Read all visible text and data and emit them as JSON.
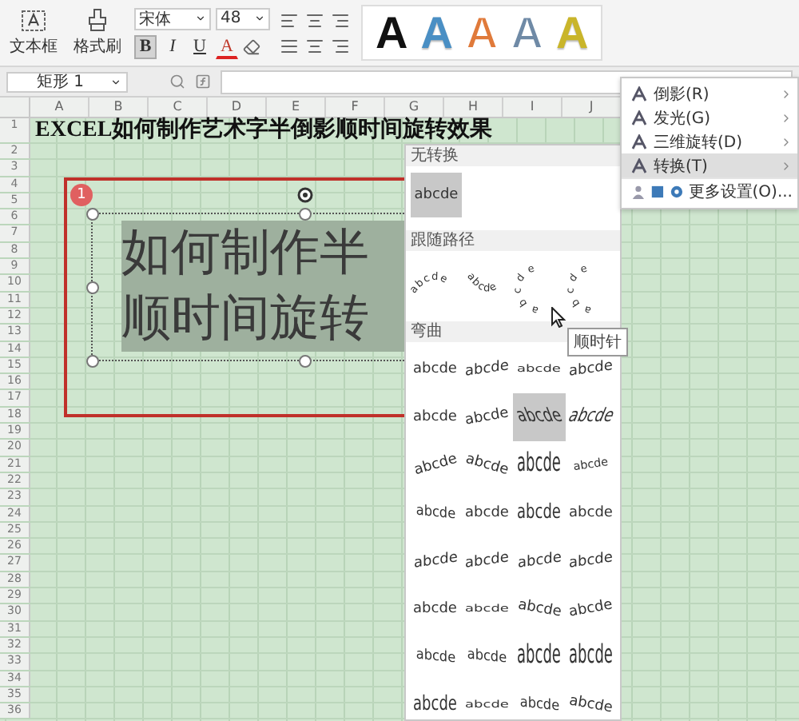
{
  "ribbon": {
    "textbox_label": "文本框",
    "format_painter_label": "格式刷",
    "font": "宋体",
    "font_size": "48",
    "bold": {
      "label": "B",
      "on": true
    },
    "italic": {
      "label": "I"
    },
    "underline": {
      "label": "U"
    },
    "font_color": {
      "label": "A"
    },
    "wordart_styles": [
      {
        "label": "A",
        "kind": "solid",
        "color": "#111111"
      },
      {
        "label": "A",
        "kind": "soft",
        "color": "#4a8fc4"
      },
      {
        "label": "A",
        "kind": "outline",
        "color": "#e07a3a"
      },
      {
        "label": "A",
        "kind": "outline",
        "color": "#6f8aa6"
      },
      {
        "label": "A",
        "kind": "soft",
        "color": "#c9b52a"
      }
    ]
  },
  "formula_bar": {
    "name_box": "矩形 1"
  },
  "columns": [
    "A",
    "B",
    "C",
    "D",
    "E",
    "F",
    "G",
    "H",
    "I",
    "J"
  ],
  "rows": [
    "1",
    "2",
    "3",
    "4",
    "5",
    "6",
    "7",
    "8",
    "9",
    "10",
    "11",
    "12",
    "13",
    "14",
    "15",
    "16",
    "17",
    "18",
    "19",
    "20",
    "21",
    "22",
    "23",
    "24",
    "25",
    "26",
    "27",
    "28",
    "29",
    "30",
    "31",
    "32",
    "33",
    "34",
    "35",
    "36"
  ],
  "title": "EXCEL如何制作艺术字半倒影顺时间旋转效果",
  "shape": {
    "badge": "1",
    "lines": [
      "如何制作半",
      "顺时间旋转"
    ]
  },
  "effects_menu": {
    "items": [
      {
        "label": "倒影(R)",
        "highlighted": false
      },
      {
        "label": "发光(G)",
        "highlighted": false
      },
      {
        "label": "三维旋转(D)",
        "highlighted": false
      },
      {
        "label": "转换(T)",
        "highlighted": true
      }
    ],
    "more": "更多设置(O)..."
  },
  "transform_gallery": {
    "sections": [
      {
        "title": "无转换",
        "kind": "single",
        "items": [
          {
            "text": "abcde",
            "kind": "plain",
            "highlighted": true
          }
        ]
      },
      {
        "title": "跟随路径",
        "kind": "path",
        "items": [
          {
            "text": "abcde",
            "kind": "arch-up",
            "highlighted": false
          },
          {
            "text": "abcde",
            "kind": "arch-down",
            "highlighted": false
          },
          {
            "text": "abcde",
            "kind": "circle",
            "highlighted": false
          },
          {
            "text": "abcde",
            "kind": "button",
            "highlighted": false
          }
        ]
      },
      {
        "title": "弯曲",
        "kind": "grid",
        "items": [
          {
            "text": "abcde",
            "kind": "plain",
            "highlighted": false
          },
          {
            "text": "abcde",
            "kind": "wave",
            "highlighted": false
          },
          {
            "text": "abcde",
            "kind": "deflate",
            "highlighted": false
          },
          {
            "text": "abcde",
            "kind": "wave",
            "highlighted": false
          },
          {
            "text": "abcde",
            "kind": "plain",
            "highlighted": false
          },
          {
            "text": "abcde",
            "kind": "slant-up",
            "highlighted": false
          },
          {
            "text": "abcde",
            "kind": "chevron-up",
            "highlighted": true
          },
          {
            "text": "abcde",
            "kind": "chevron-down",
            "highlighted": false
          },
          {
            "text": "abcde",
            "kind": "arch",
            "highlighted": false
          },
          {
            "text": "abcde",
            "kind": "arch-down",
            "highlighted": false
          },
          {
            "text": "abcde",
            "kind": "stack",
            "highlighted": false
          },
          {
            "text": "abcde",
            "kind": "circle",
            "highlighted": false
          },
          {
            "text": "abcde",
            "kind": "fade",
            "highlighted": false
          },
          {
            "text": "abcde",
            "kind": "plain",
            "highlighted": false
          },
          {
            "text": "abcde",
            "kind": "inflate",
            "highlighted": false
          },
          {
            "text": "abcde",
            "kind": "plain",
            "highlighted": false
          },
          {
            "text": "abcde",
            "kind": "wave",
            "highlighted": false
          },
          {
            "text": "abcde",
            "kind": "wave",
            "highlighted": false
          },
          {
            "text": "abcde",
            "kind": "wave",
            "highlighted": false
          },
          {
            "text": "abcde",
            "kind": "wave",
            "highlighted": false
          },
          {
            "text": "abcde",
            "kind": "plain",
            "highlighted": false
          },
          {
            "text": "abcde",
            "kind": "deflate",
            "highlighted": false
          },
          {
            "text": "abcde",
            "kind": "slant-down",
            "highlighted": false
          },
          {
            "text": "abcde",
            "kind": "slant-up",
            "highlighted": false
          },
          {
            "text": "abcde",
            "kind": "fade",
            "highlighted": false
          },
          {
            "text": "abcde",
            "kind": "fade",
            "highlighted": false
          },
          {
            "text": "abcde",
            "kind": "stack",
            "highlighted": false
          },
          {
            "text": "abcde",
            "kind": "stack",
            "highlighted": false
          },
          {
            "text": "abcde",
            "kind": "inflate",
            "highlighted": false
          },
          {
            "text": "abcde",
            "kind": "deflate",
            "highlighted": false
          },
          {
            "text": "abcde",
            "kind": "fade",
            "highlighted": false
          },
          {
            "text": "abcde",
            "kind": "slant-down",
            "highlighted": false
          }
        ]
      }
    ]
  },
  "tooltip": "顺时针"
}
